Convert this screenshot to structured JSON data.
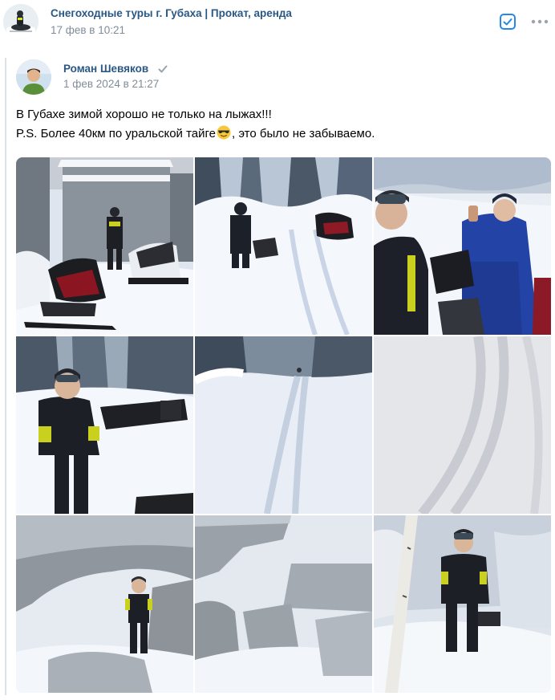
{
  "group": {
    "name": "Снегоходные туры г. Губаха | Прокат, аренда",
    "date": "17 фев в 10:21"
  },
  "author": {
    "name": "Роман Шевяков",
    "date": "1 фев 2024 в 21:27"
  },
  "post": {
    "line1": "В Губахе зимой хорошо не только на лыжах!!!",
    "line2_before_emoji": "P.S. Более 40км по уральской тайге",
    "line2_after_emoji": ", это было не забываемо."
  },
  "icons": {
    "check": "checkbox-icon",
    "more": "more-dots-icon",
    "verified": "verified-check-icon",
    "emoji": "sunglasses-emoji-icon"
  },
  "colors": {
    "link": "#2a5885",
    "secondary": "#818c99",
    "accent": "#2688eb",
    "divider": "#dce1e6"
  },
  "photos": [
    {
      "subject": "snowmobiles-by-garage"
    },
    {
      "subject": "rider-by-snowmobile-in-forest"
    },
    {
      "subject": "two-riders-selfie"
    },
    {
      "subject": "rider-standing-with-snowmobiles"
    },
    {
      "subject": "snowmobile-trail-through-forest"
    },
    {
      "subject": "snow-tracks-closeup"
    },
    {
      "subject": "rider-under-rock-arch"
    },
    {
      "subject": "snowy-rock-formations"
    },
    {
      "subject": "rider-by-birch-tree"
    }
  ]
}
